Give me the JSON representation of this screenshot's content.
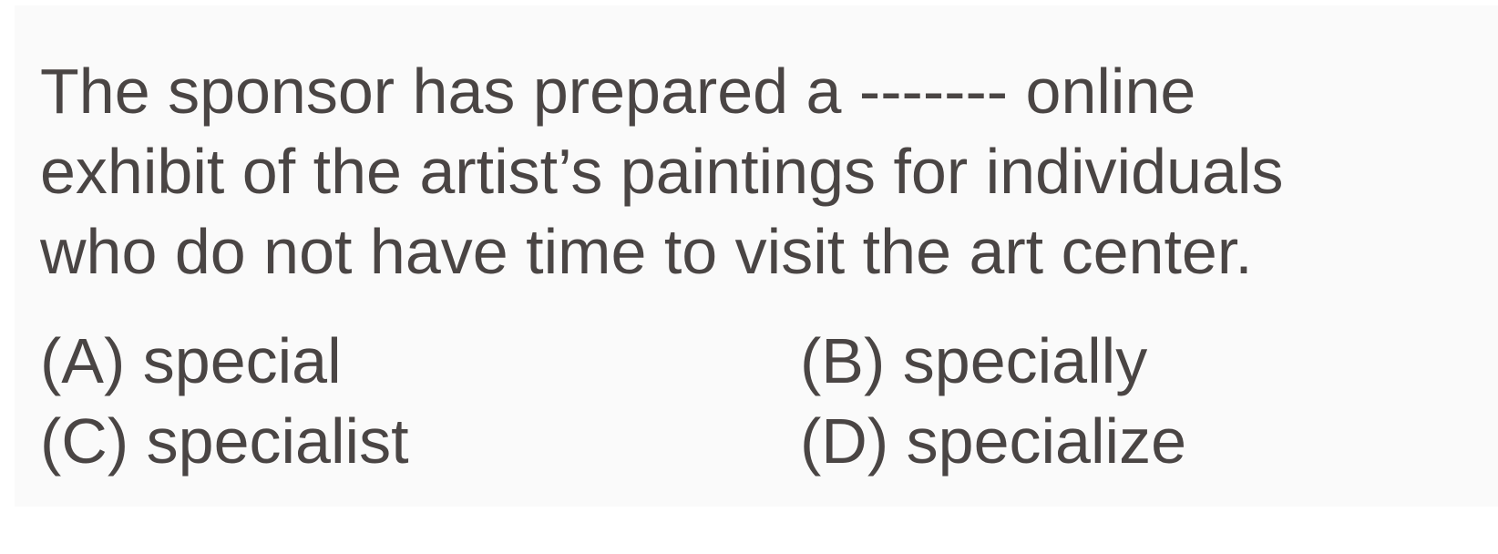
{
  "question": {
    "lines": [
      "The sponsor has prepared a ------- online",
      "exhibit of the artist’s paintings for individuals",
      "who do not have time to visit the art center."
    ]
  },
  "options": [
    {
      "letter": "(A)",
      "text": "special"
    },
    {
      "letter": "(B)",
      "text": "specially"
    },
    {
      "letter": "(C)",
      "text": "specialist"
    },
    {
      "letter": "(D)",
      "text": "specialize"
    }
  ]
}
